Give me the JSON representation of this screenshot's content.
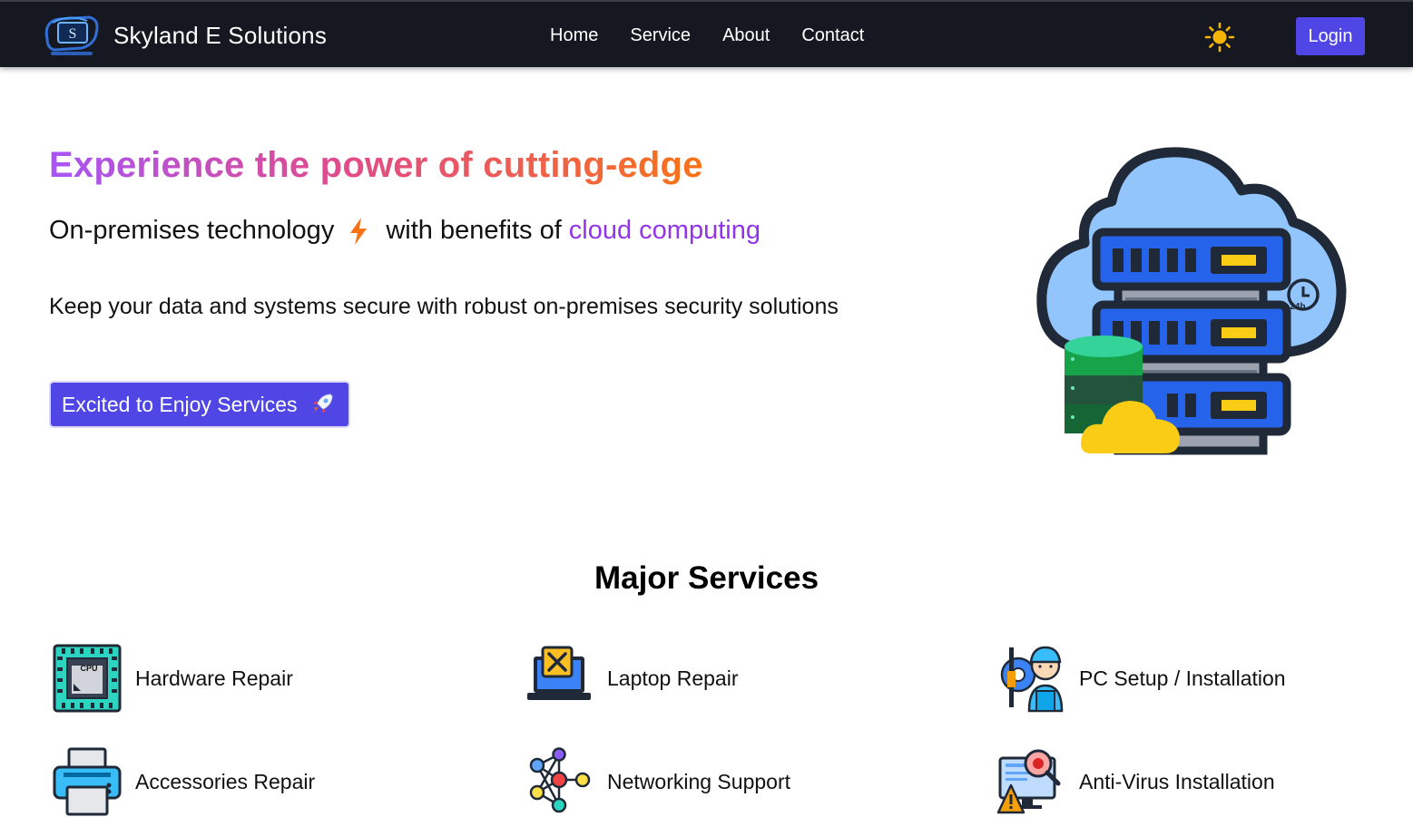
{
  "navbar": {
    "brand_name": "Skyland E Solutions",
    "links": [
      "Home",
      "Service",
      "About",
      "Contact"
    ],
    "login_label": "Login",
    "theme_icon": "sun-icon",
    "background": "#151821",
    "accent": "#4f46e5"
  },
  "hero": {
    "title": "Experience the power of cutting-edge",
    "subtitle_part1": "On-premises technology",
    "subtitle_part2": "with benefits of",
    "subtitle_highlight": "cloud computing",
    "description": "Keep your data and systems secure with robust on-premises security solutions",
    "cta_label": "Excited to Enjoy Services",
    "title_gradient": [
      "#a855f7",
      "#e14b8a",
      "#f97316"
    ],
    "highlight_color": "#9333ea"
  },
  "services": {
    "title": "Major Services",
    "items": [
      {
        "label": "Hardware Repair",
        "icon": "cpu-chip-icon"
      },
      {
        "label": "Laptop Repair",
        "icon": "laptop-tools-icon"
      },
      {
        "label": "PC Setup / Installation",
        "icon": "technician-icon"
      },
      {
        "label": "Accessories Repair",
        "icon": "printer-icon"
      },
      {
        "label": "Networking Support",
        "icon": "network-nodes-icon"
      },
      {
        "label": "Anti-Virus Installation",
        "icon": "virus-warning-icon"
      }
    ]
  }
}
